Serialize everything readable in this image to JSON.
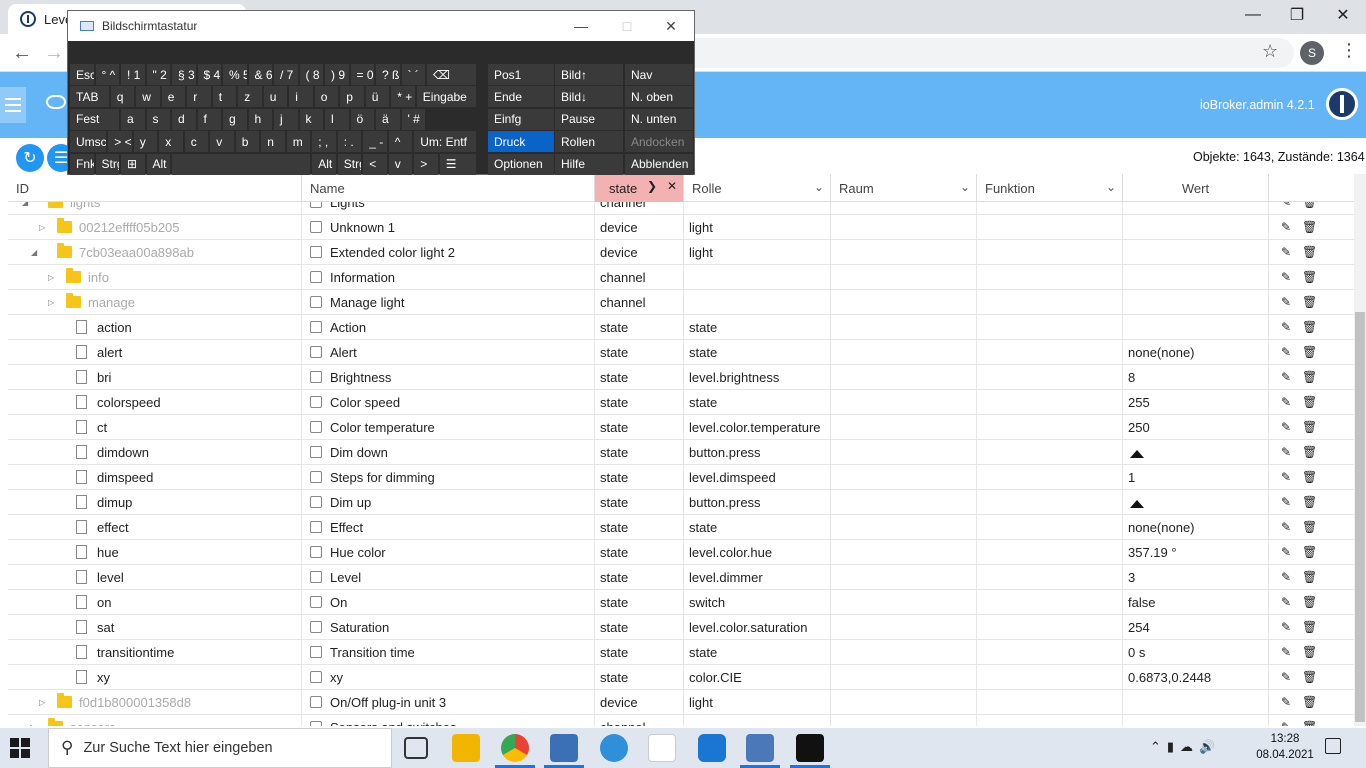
{
  "browser": {
    "tab_title": "Leve",
    "profile_initial": "S"
  },
  "app": {
    "version": "ioBroker.admin 4.2.1",
    "counts": "Objekte: 1643, Zustände: 1364"
  },
  "columns": {
    "id": "ID",
    "name": "Name",
    "type": "state",
    "role": "Rolle",
    "room": "Raum",
    "function": "Funktion",
    "value": "Wert"
  },
  "rows": [
    {
      "id": "lights",
      "name": "Lights",
      "type": "channel",
      "role": "",
      "value": "",
      "icon": "folder",
      "level": 1,
      "expander": "open",
      "faded": true
    },
    {
      "id": "00212effff05b205",
      "name": "Unknown 1",
      "type": "device",
      "role": "light",
      "value": "",
      "icon": "folder",
      "level": 2,
      "expander": "closed",
      "faded": true
    },
    {
      "id": "7cb03eaa00a898ab",
      "name": "Extended color light 2",
      "type": "device",
      "role": "light",
      "value": "",
      "icon": "folder",
      "level": 2,
      "expander": "open",
      "faded": true
    },
    {
      "id": "info",
      "name": "Information",
      "type": "channel",
      "role": "",
      "value": "",
      "icon": "folder",
      "level": 3,
      "expander": "closed",
      "faded": true
    },
    {
      "id": "manage",
      "name": "Manage light",
      "type": "channel",
      "role": "",
      "value": "",
      "icon": "folder",
      "level": 3,
      "expander": "closed",
      "faded": true
    },
    {
      "id": "action",
      "name": "Action",
      "type": "state",
      "role": "state",
      "value": "",
      "icon": "file",
      "level": 3,
      "expander": "none",
      "faded": false
    },
    {
      "id": "alert",
      "name": "Alert",
      "type": "state",
      "role": "state",
      "value": "none(none)",
      "icon": "file",
      "level": 3,
      "expander": "none",
      "faded": false
    },
    {
      "id": "bri",
      "name": "Brightness",
      "type": "state",
      "role": "level.brightness",
      "value": "8",
      "icon": "file",
      "level": 3,
      "expander": "none",
      "faded": false
    },
    {
      "id": "colorspeed",
      "name": "Color speed",
      "type": "state",
      "role": "state",
      "value": "255",
      "icon": "file",
      "level": 3,
      "expander": "none",
      "faded": false
    },
    {
      "id": "ct",
      "name": "Color temperature",
      "type": "state",
      "role": "level.color.temperature",
      "value": "250",
      "icon": "file",
      "level": 3,
      "expander": "none",
      "faded": false
    },
    {
      "id": "dimdown",
      "name": "Dim down",
      "type": "state",
      "role": "button.press",
      "value": "",
      "value_icon": "bell-icon",
      "icon": "file",
      "level": 3,
      "expander": "none",
      "faded": false
    },
    {
      "id": "dimspeed",
      "name": "Steps for dimming",
      "type": "state",
      "role": "level.dimspeed",
      "value": "1",
      "icon": "file",
      "level": 3,
      "expander": "none",
      "faded": false
    },
    {
      "id": "dimup",
      "name": "Dim up",
      "type": "state",
      "role": "button.press",
      "value": "",
      "value_icon": "bell-icon",
      "icon": "file",
      "level": 3,
      "expander": "none",
      "faded": false
    },
    {
      "id": "effect",
      "name": "Effect",
      "type": "state",
      "role": "state",
      "value": "none(none)",
      "icon": "file",
      "level": 3,
      "expander": "none",
      "faded": false
    },
    {
      "id": "hue",
      "name": "Hue color",
      "type": "state",
      "role": "level.color.hue",
      "value": "357.19 °",
      "icon": "file",
      "level": 3,
      "expander": "none",
      "faded": false
    },
    {
      "id": "level",
      "name": "Level",
      "type": "state",
      "role": "level.dimmer",
      "value": "3",
      "icon": "file",
      "level": 3,
      "expander": "none",
      "faded": false
    },
    {
      "id": "on",
      "name": "On",
      "type": "state",
      "role": "switch",
      "value": "false",
      "icon": "file",
      "level": 3,
      "expander": "none",
      "faded": false
    },
    {
      "id": "sat",
      "name": "Saturation",
      "type": "state",
      "role": "level.color.saturation",
      "value": "254",
      "icon": "file",
      "level": 3,
      "expander": "none",
      "faded": false
    },
    {
      "id": "transitiontime",
      "name": "Transition time",
      "type": "state",
      "role": "state",
      "value": "0 s",
      "icon": "file",
      "level": 3,
      "expander": "none",
      "faded": false
    },
    {
      "id": "xy",
      "name": "xy",
      "type": "state",
      "role": "color.CIE",
      "value": "0.6873,0.2448",
      "icon": "file",
      "level": 3,
      "expander": "none",
      "faded": false
    },
    {
      "id": "f0d1b800001358d8",
      "name": "On/Off plug-in unit 3",
      "type": "device",
      "role": "light",
      "value": "",
      "icon": "folder",
      "level": 2,
      "expander": "closed",
      "faded": true
    },
    {
      "id": "sensors",
      "name": "Sensors and switches",
      "type": "channel",
      "role": "",
      "value": "",
      "icon": "folder",
      "level": 1,
      "expander": "closed",
      "faded": true
    }
  ],
  "osk": {
    "title": "Bildschirmtastatur",
    "keys": [
      {
        "label": "Esc",
        "row": 0,
        "col": 0,
        "w": 1
      },
      {
        "label": "° ^",
        "row": 0,
        "col": 1,
        "w": 1
      },
      {
        "label": "! 1",
        "row": 0,
        "col": 2,
        "w": 1
      },
      {
        "label": "\" 2",
        "row": 0,
        "col": 3,
        "w": 1
      },
      {
        "label": "§ 3",
        "row": 0,
        "col": 4,
        "w": 1
      },
      {
        "label": "$ 4",
        "row": 0,
        "col": 5,
        "w": 1
      },
      {
        "label": "% 5",
        "row": 0,
        "col": 6,
        "w": 1
      },
      {
        "label": "& 6",
        "row": 0,
        "col": 7,
        "w": 1
      },
      {
        "label": "/ 7",
        "row": 0,
        "col": 8,
        "w": 1
      },
      {
        "label": "( 8",
        "row": 0,
        "col": 9,
        "w": 1
      },
      {
        "label": ") 9",
        "row": 0,
        "col": 10,
        "w": 1
      },
      {
        "label": "= 0",
        "row": 0,
        "col": 11,
        "w": 1
      },
      {
        "label": "? ß",
        "row": 0,
        "col": 12,
        "w": 1
      },
      {
        "label": "` ´",
        "row": 0,
        "col": 13,
        "w": 1
      },
      {
        "label": "⌫",
        "row": 0,
        "col": 14,
        "w": 2
      },
      {
        "label": "TAB",
        "row": 1,
        "col": 0,
        "w": 1.6
      },
      {
        "label": "q",
        "row": 1,
        "col": 1.6,
        "w": 1
      },
      {
        "label": "w",
        "row": 1,
        "col": 2.6,
        "w": 1
      },
      {
        "label": "e",
        "row": 1,
        "col": 3.6,
        "w": 1
      },
      {
        "label": "r",
        "row": 1,
        "col": 4.6,
        "w": 1
      },
      {
        "label": "t",
        "row": 1,
        "col": 5.6,
        "w": 1
      },
      {
        "label": "z",
        "row": 1,
        "col": 6.6,
        "w": 1
      },
      {
        "label": "u",
        "row": 1,
        "col": 7.6,
        "w": 1
      },
      {
        "label": "i",
        "row": 1,
        "col": 8.6,
        "w": 1
      },
      {
        "label": "o",
        "row": 1,
        "col": 9.6,
        "w": 1
      },
      {
        "label": "p",
        "row": 1,
        "col": 10.6,
        "w": 1
      },
      {
        "label": "ü",
        "row": 1,
        "col": 11.6,
        "w": 1
      },
      {
        "label": "* +",
        "row": 1,
        "col": 12.6,
        "w": 1
      },
      {
        "label": "Eingabe",
        "row": 1,
        "col": 13.6,
        "w": 2.4
      },
      {
        "label": "Fest",
        "row": 2,
        "col": 0,
        "w": 2
      },
      {
        "label": "a",
        "row": 2,
        "col": 2,
        "w": 1
      },
      {
        "label": "s",
        "row": 2,
        "col": 3,
        "w": 1
      },
      {
        "label": "d",
        "row": 2,
        "col": 4,
        "w": 1
      },
      {
        "label": "f",
        "row": 2,
        "col": 5,
        "w": 1
      },
      {
        "label": "g",
        "row": 2,
        "col": 6,
        "w": 1
      },
      {
        "label": "h",
        "row": 2,
        "col": 7,
        "w": 1
      },
      {
        "label": "j",
        "row": 2,
        "col": 8,
        "w": 1
      },
      {
        "label": "k",
        "row": 2,
        "col": 9,
        "w": 1
      },
      {
        "label": "l",
        "row": 2,
        "col": 10,
        "w": 1
      },
      {
        "label": "ö",
        "row": 2,
        "col": 11,
        "w": 1
      },
      {
        "label": "ä",
        "row": 2,
        "col": 12,
        "w": 1
      },
      {
        "label": "' #",
        "row": 2,
        "col": 13,
        "w": 1
      },
      {
        "label": "Umsch",
        "row": 3,
        "col": 0,
        "w": 1.5
      },
      {
        "label": "> <",
        "row": 3,
        "col": 1.5,
        "w": 1
      },
      {
        "label": "y",
        "row": 3,
        "col": 2.5,
        "w": 1
      },
      {
        "label": "x",
        "row": 3,
        "col": 3.5,
        "w": 1
      },
      {
        "label": "c",
        "row": 3,
        "col": 4.5,
        "w": 1
      },
      {
        "label": "v",
        "row": 3,
        "col": 5.5,
        "w": 1
      },
      {
        "label": "b",
        "row": 3,
        "col": 6.5,
        "w": 1
      },
      {
        "label": "n",
        "row": 3,
        "col": 7.5,
        "w": 1
      },
      {
        "label": "m",
        "row": 3,
        "col": 8.5,
        "w": 1
      },
      {
        "label": "; ,",
        "row": 3,
        "col": 9.5,
        "w": 1
      },
      {
        "label": ": .",
        "row": 3,
        "col": 10.5,
        "w": 1
      },
      {
        "label": "_ -",
        "row": 3,
        "col": 11.5,
        "w": 1
      },
      {
        "label": "^",
        "row": 3,
        "col": 12.5,
        "w": 1
      },
      {
        "label": "Um: Entf",
        "row": 3,
        "col": 13.5,
        "w": 2.5
      },
      {
        "label": "Fnkt",
        "row": 4,
        "col": 0,
        "w": 1
      },
      {
        "label": "Strg",
        "row": 4,
        "col": 1,
        "w": 1
      },
      {
        "label": "⊞",
        "row": 4,
        "col": 2,
        "w": 1
      },
      {
        "label": "Alt",
        "row": 4,
        "col": 3,
        "w": 1
      },
      {
        "label": "",
        "row": 4,
        "col": 4,
        "w": 5.5
      },
      {
        "label": "Alt Gr",
        "row": 4,
        "col": 9.5,
        "w": 1
      },
      {
        "label": "Strg",
        "row": 4,
        "col": 10.5,
        "w": 1
      },
      {
        "label": "<",
        "row": 4,
        "col": 11.5,
        "w": 1
      },
      {
        "label": "v",
        "row": 4,
        "col": 12.5,
        "w": 1
      },
      {
        "label": ">",
        "row": 4,
        "col": 13.5,
        "w": 1
      },
      {
        "label": "☰",
        "row": 4,
        "col": 14.5,
        "w": 1.5
      }
    ],
    "side_keys": [
      [
        "Pos1",
        "Bild↑",
        "Nav"
      ],
      [
        "Ende",
        "Bild↓",
        "N. oben"
      ],
      [
        "Einfg",
        "Pause",
        "N. unten"
      ],
      [
        "Druck",
        "Rollen",
        "Andocken"
      ],
      [
        "Optionen",
        "Hilfe",
        "Abblenden"
      ]
    ]
  },
  "taskbar": {
    "search_placeholder": "Zur Suche Text hier eingeben",
    "time": "13:28",
    "date": "08.04.2021"
  }
}
